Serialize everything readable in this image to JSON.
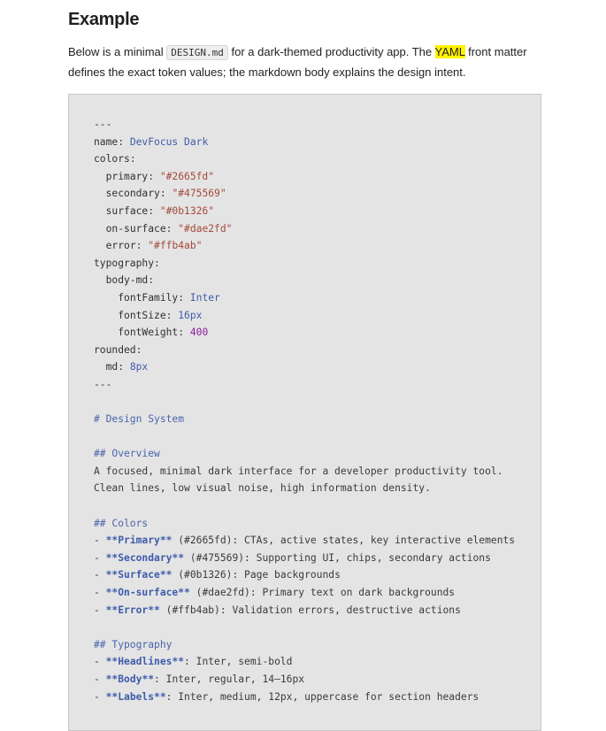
{
  "heading": "Example",
  "intro": {
    "before_chip": "Below is a minimal ",
    "chip": "DESIGN.md",
    "after_chip": " for a dark-themed productivity app. The ",
    "highlight": "YAML",
    "after_highlight": " front matter defines the exact token values; the markdown body explains the design intent."
  },
  "code": {
    "front_matter": {
      "delimiter": "---",
      "name_key": "name",
      "name_value": "DevFocus Dark",
      "colors_key": "colors",
      "colors": [
        {
          "key": "primary",
          "value": "\"#2665fd\""
        },
        {
          "key": "secondary",
          "value": "\"#475569\""
        },
        {
          "key": "surface",
          "value": "\"#0b1326\""
        },
        {
          "key": "on-surface",
          "value": "\"#dae2fd\""
        },
        {
          "key": "error",
          "value": "\"#ffb4ab\""
        }
      ],
      "typography_key": "typography",
      "body_md_key": "body-md",
      "font_family_key": "fontFamily",
      "font_family_value": "Inter",
      "font_size_key": "fontSize",
      "font_size_value": "16px",
      "font_weight_key": "fontWeight",
      "font_weight_value": "400",
      "rounded_key": "rounded",
      "md_key": "md",
      "md_value": "8px"
    },
    "body": {
      "h1": "# Design System",
      "overview_heading": "## Overview",
      "overview_lines": [
        "A focused, minimal dark interface for a developer productivity tool.",
        "Clean lines, low visual noise, high information density."
      ],
      "colors_heading": "## Colors",
      "color_items": [
        {
          "name": "Primary",
          "desc": " (#2665fd): CTAs, active states, key interactive elements"
        },
        {
          "name": "Secondary",
          "desc": " (#475569): Supporting UI, chips, secondary actions"
        },
        {
          "name": "Surface",
          "desc": " (#0b1326): Page backgrounds"
        },
        {
          "name": "On-surface",
          "desc": " (#dae2fd): Primary text on dark backgrounds"
        },
        {
          "name": "Error",
          "desc": " (#ffb4ab): Validation errors, destructive actions"
        }
      ],
      "typography_heading": "## Typography",
      "typo_items": [
        {
          "name": "Headlines",
          "desc": ": Inter, semi-bold"
        },
        {
          "name": "Body",
          "desc": ": Inter, regular, 14–16px"
        },
        {
          "name": "Labels",
          "desc": ": Inter, medium, 12px, uppercase for section headers"
        }
      ]
    }
  },
  "colors": {
    "code_background": "#e4e4e4",
    "highlight": "#fff200",
    "string": "#a3493b",
    "value": "#3f5cab",
    "number": "#8a1c9a"
  }
}
